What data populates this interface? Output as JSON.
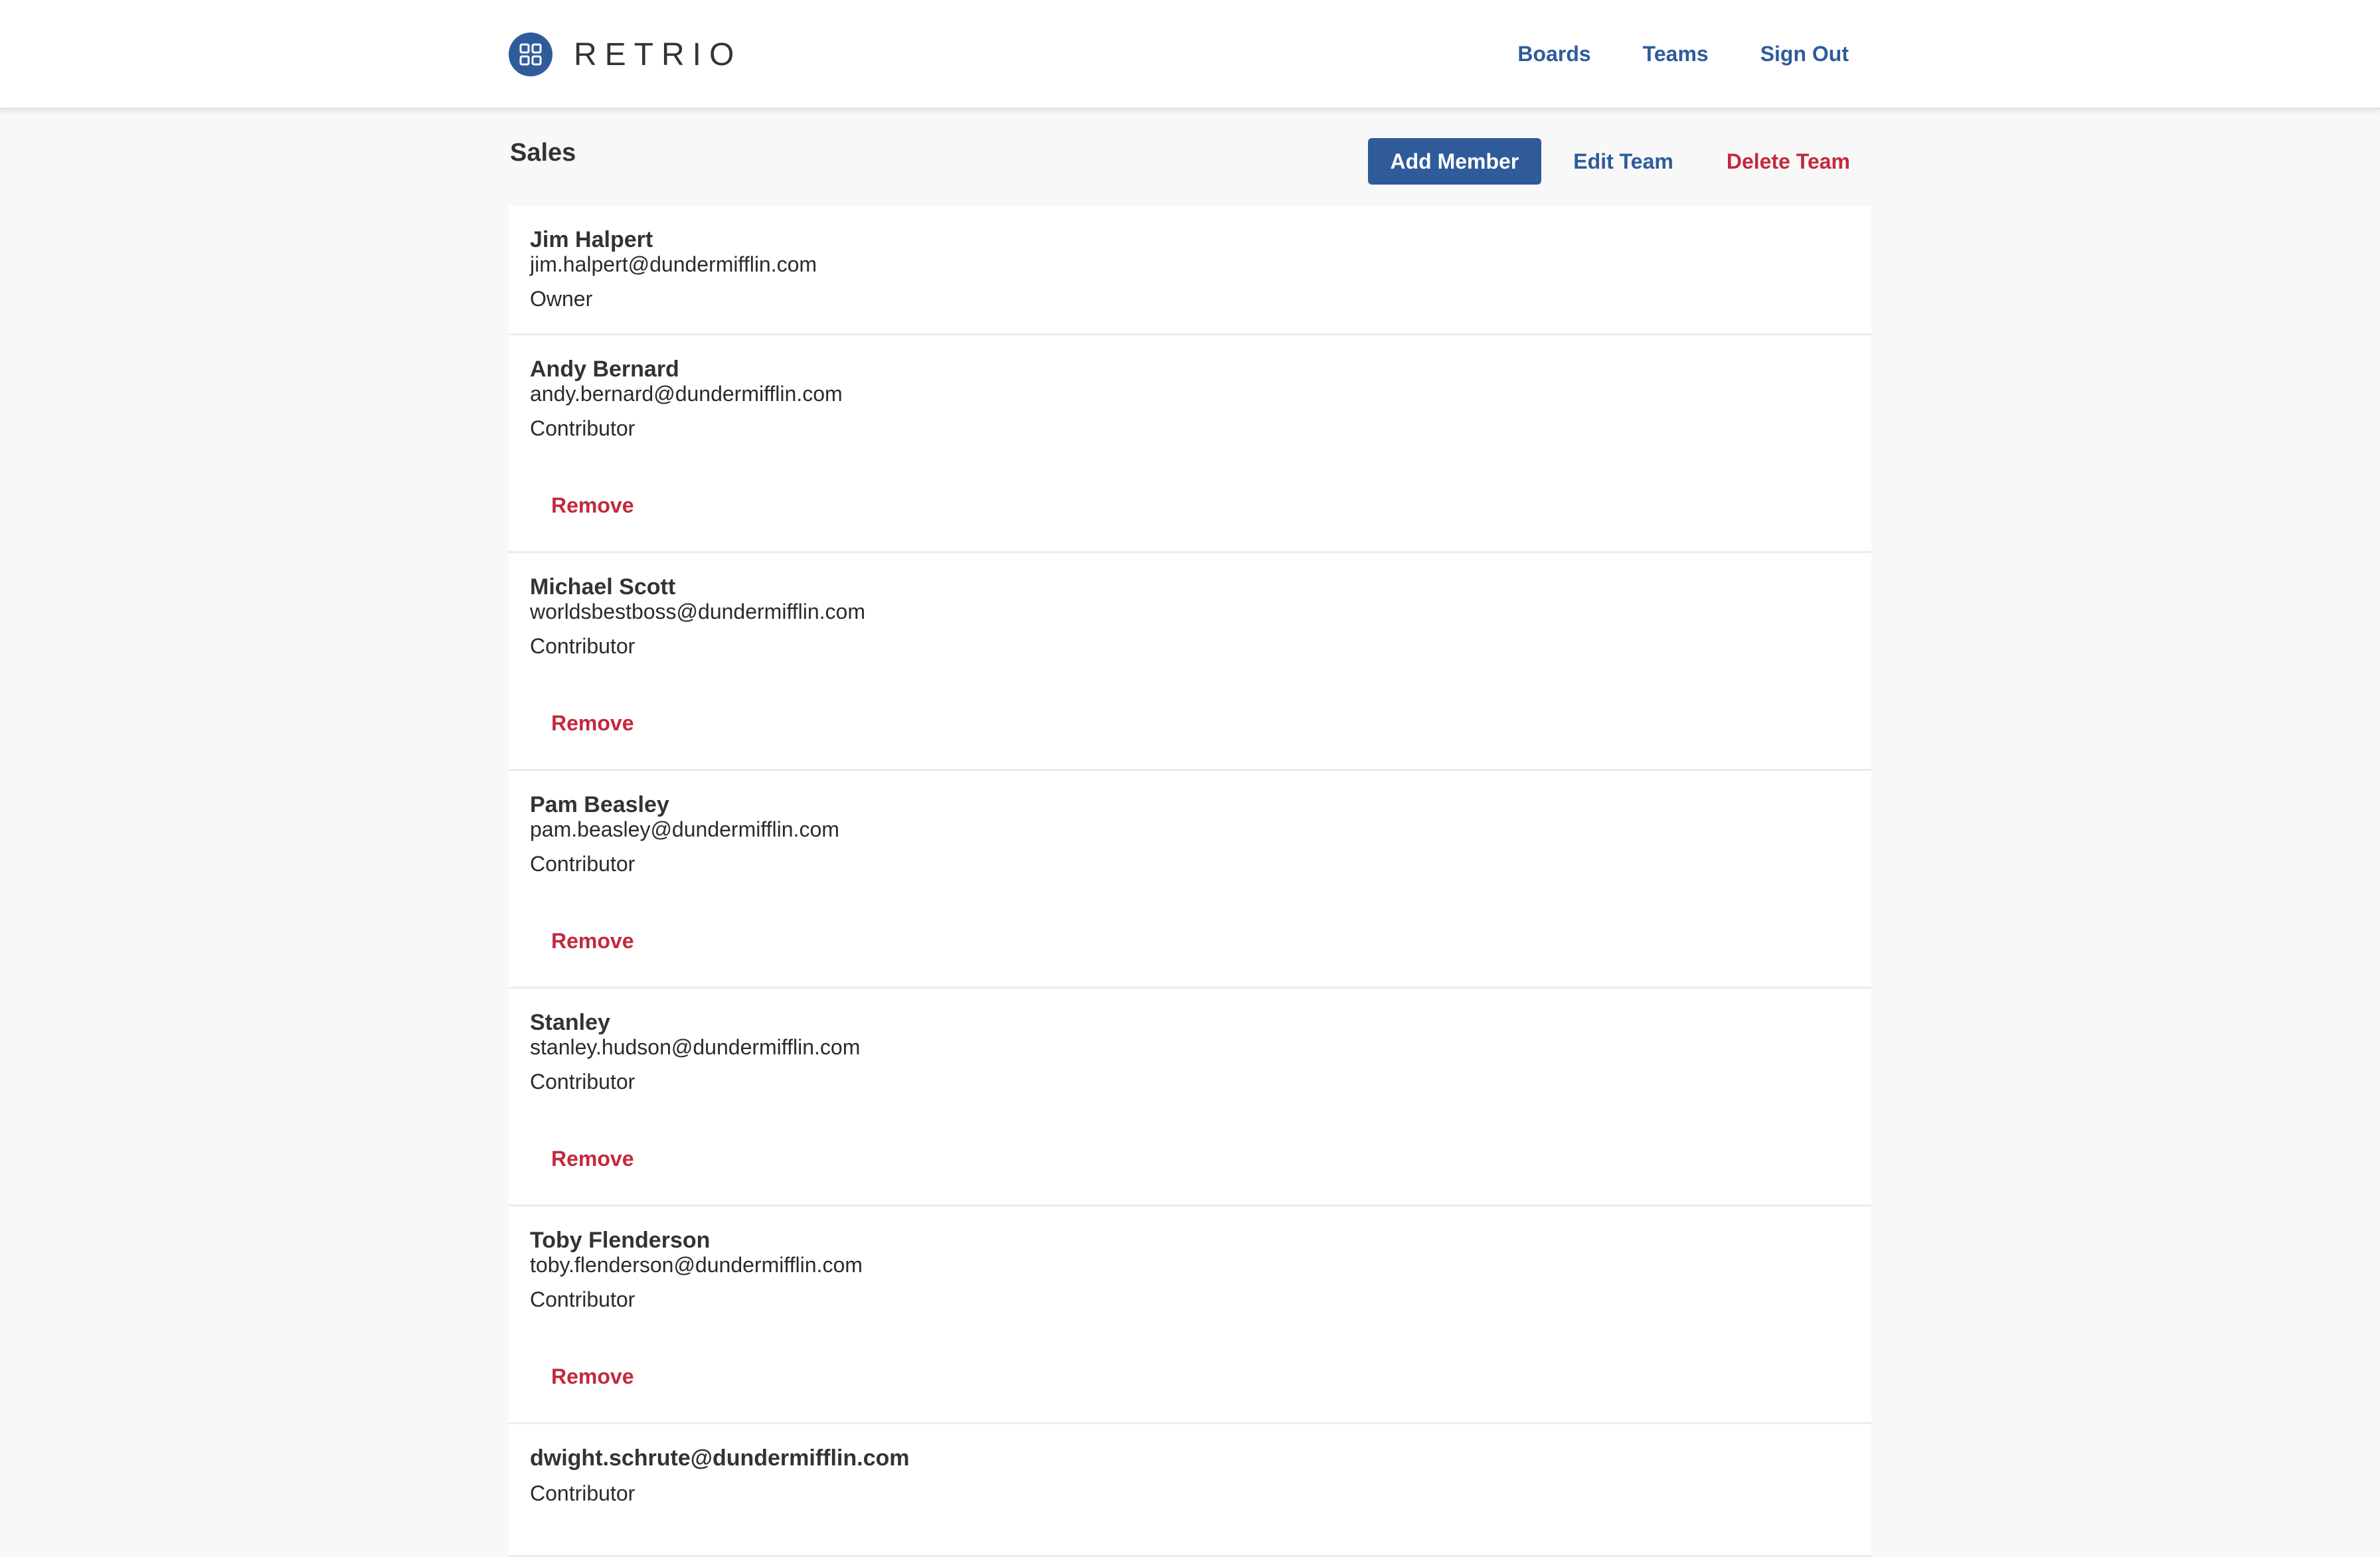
{
  "app": {
    "name": "RETRIO",
    "logo_icon": "grid-icon",
    "accent": "#2f5b9b",
    "danger": "#c3293d"
  },
  "nav": {
    "boards": "Boards",
    "teams": "Teams",
    "sign_out": "Sign Out"
  },
  "team": {
    "name": "Sales",
    "add_member": "Add Member",
    "edit_team": "Edit Team",
    "delete_team": "Delete Team"
  },
  "members": [
    {
      "name": "Jim Halpert",
      "email": "jim.halpert@dundermifflin.com",
      "role": "Owner"
    },
    {
      "name": "Andy Bernard",
      "email": "andy.bernard@dundermifflin.com",
      "role": "Contributor",
      "action": "Remove"
    },
    {
      "name": "Michael Scott",
      "email": "worldsbestboss@dundermifflin.com",
      "role": "Contributor",
      "action": "Remove"
    },
    {
      "name": "Pam Beasley",
      "email": "pam.beasley@dundermifflin.com",
      "role": "Contributor",
      "action": "Remove"
    },
    {
      "name": "Stanley",
      "email": "stanley.hudson@dundermifflin.com",
      "role": "Contributor",
      "action": "Remove"
    },
    {
      "name": "Toby Flenderson",
      "email": "toby.flenderson@dundermifflin.com",
      "role": "Contributor",
      "action": "Remove"
    },
    {
      "name": "dwight.schrute@dundermifflin.com",
      "role": "Contributor"
    }
  ]
}
